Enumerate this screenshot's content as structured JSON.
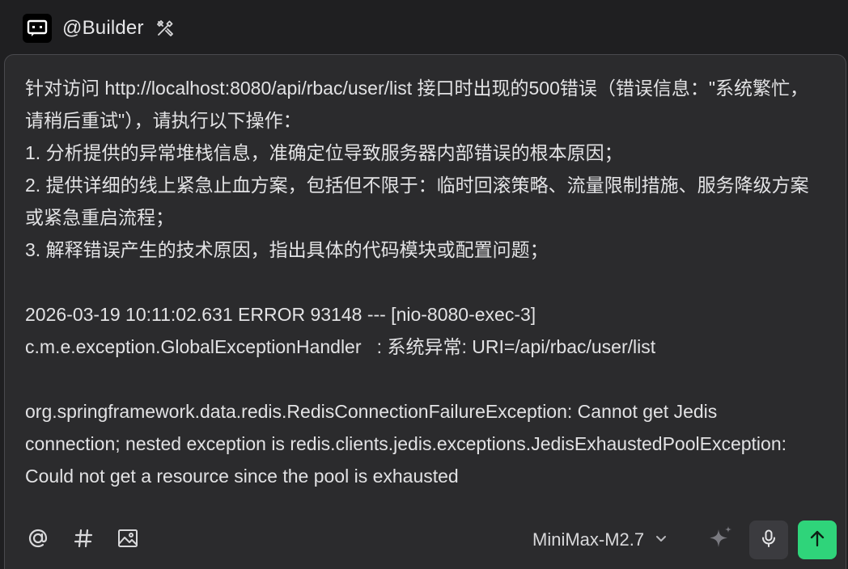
{
  "header": {
    "agent_name": "@Builder",
    "avatar_icon": "robot-terminal-icon",
    "tools_icon": "tools-icon"
  },
  "prompt": {
    "text": "针对访问 http://localhost:8080/api/rbac/user/list 接口时出现的500错误（错误信息：\"系统繁忙，请稍后重试\"），请执行以下操作：\n1. 分析提供的异常堆栈信息，准确定位导致服务器内部错误的根本原因；\n2. 提供详细的线上紧急止血方案，包括但不限于：临时回滚策略、流量限制措施、服务降级方案或紧急重启流程；\n3. 解释错误产生的技术原因，指出具体的代码模块或配置问题；\n\n2026-03-19 10:11:02.631 ERROR 93148 --- [nio-8080-exec-3]\nc.m.e.exception.GlobalExceptionHandler   : 系统异常: URI=/api/rbac/user/list\n\norg.springframework.data.redis.RedisConnectionFailureException: Cannot get Jedis connection; nested exception is redis.clients.jedis.exceptions.JedisExhaustedPoolException: Could not get a resource since the pool is exhausted"
  },
  "toolbar": {
    "mention_icon": "at-sign-icon",
    "hash_icon": "hash-icon",
    "image_icon": "image-icon",
    "model_label": "MiniMax-M2.7",
    "model_chevron_icon": "chevron-down-icon",
    "sparkle_icon": "sparkle-icon",
    "mic_icon": "microphone-icon",
    "send_icon": "arrow-up-icon"
  },
  "colors": {
    "background": "#1f1f21",
    "panel": "#2b2b2d",
    "panel_border": "#4a4a4e",
    "text": "#e2e2e4",
    "send_accent": "#2fd47a",
    "mic_bg": "#3b3b3f"
  }
}
